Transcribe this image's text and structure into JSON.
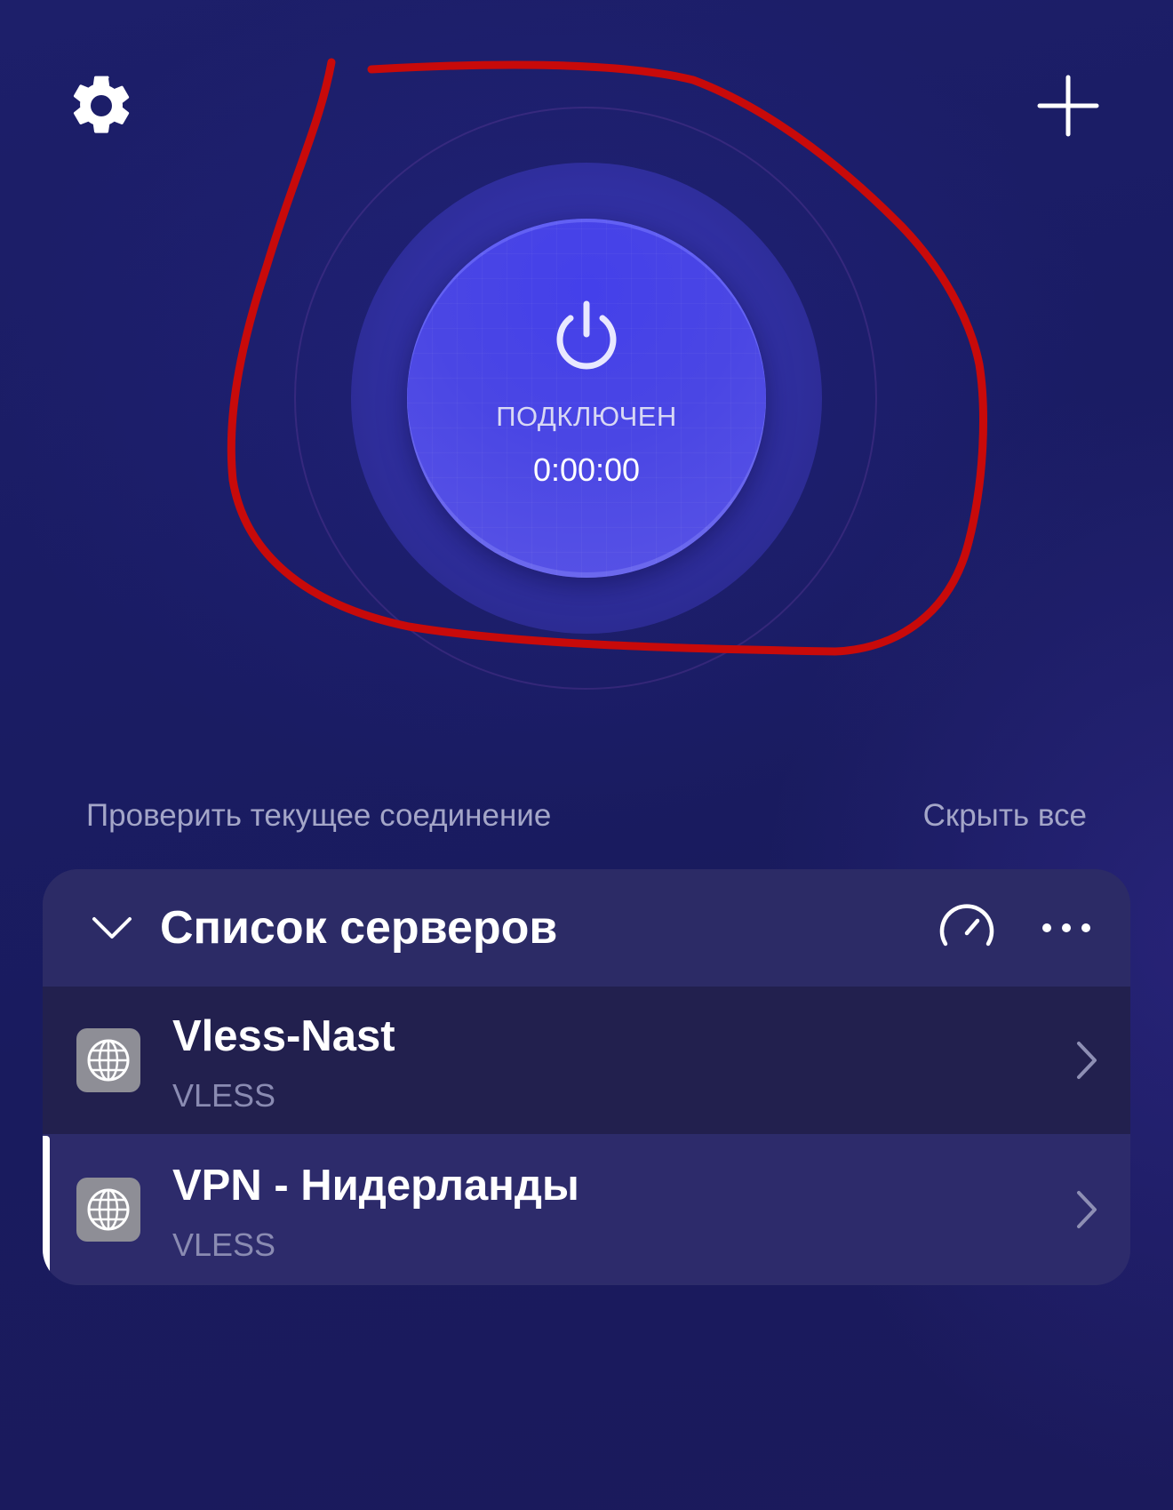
{
  "toolbar": {
    "settings_icon": "gear-icon",
    "add_icon": "plus-icon"
  },
  "connection": {
    "status": "ПОДКЛЮЧЕН",
    "timer": "0:00:00",
    "power_icon": "power-icon"
  },
  "links": {
    "check_connection": "Проверить текущее соединение",
    "hide_all": "Скрыть все"
  },
  "server_list": {
    "title": "Список серверов",
    "collapse_icon": "chevron-down-icon",
    "speed_icon": "speedometer-icon",
    "more_icon": "more-dots-icon",
    "items": [
      {
        "name": "Vless-Nast",
        "protocol": "VLESS",
        "icon": "globe-icon",
        "selected": false
      },
      {
        "name": "VPN - Нидерланды",
        "protocol": "VLESS",
        "icon": "globe-icon",
        "selected": true
      }
    ]
  },
  "colors": {
    "background": "#1b1c64",
    "button": "#4a46e4",
    "card": "#2d2c6a",
    "annotation": "#c80a0a"
  }
}
